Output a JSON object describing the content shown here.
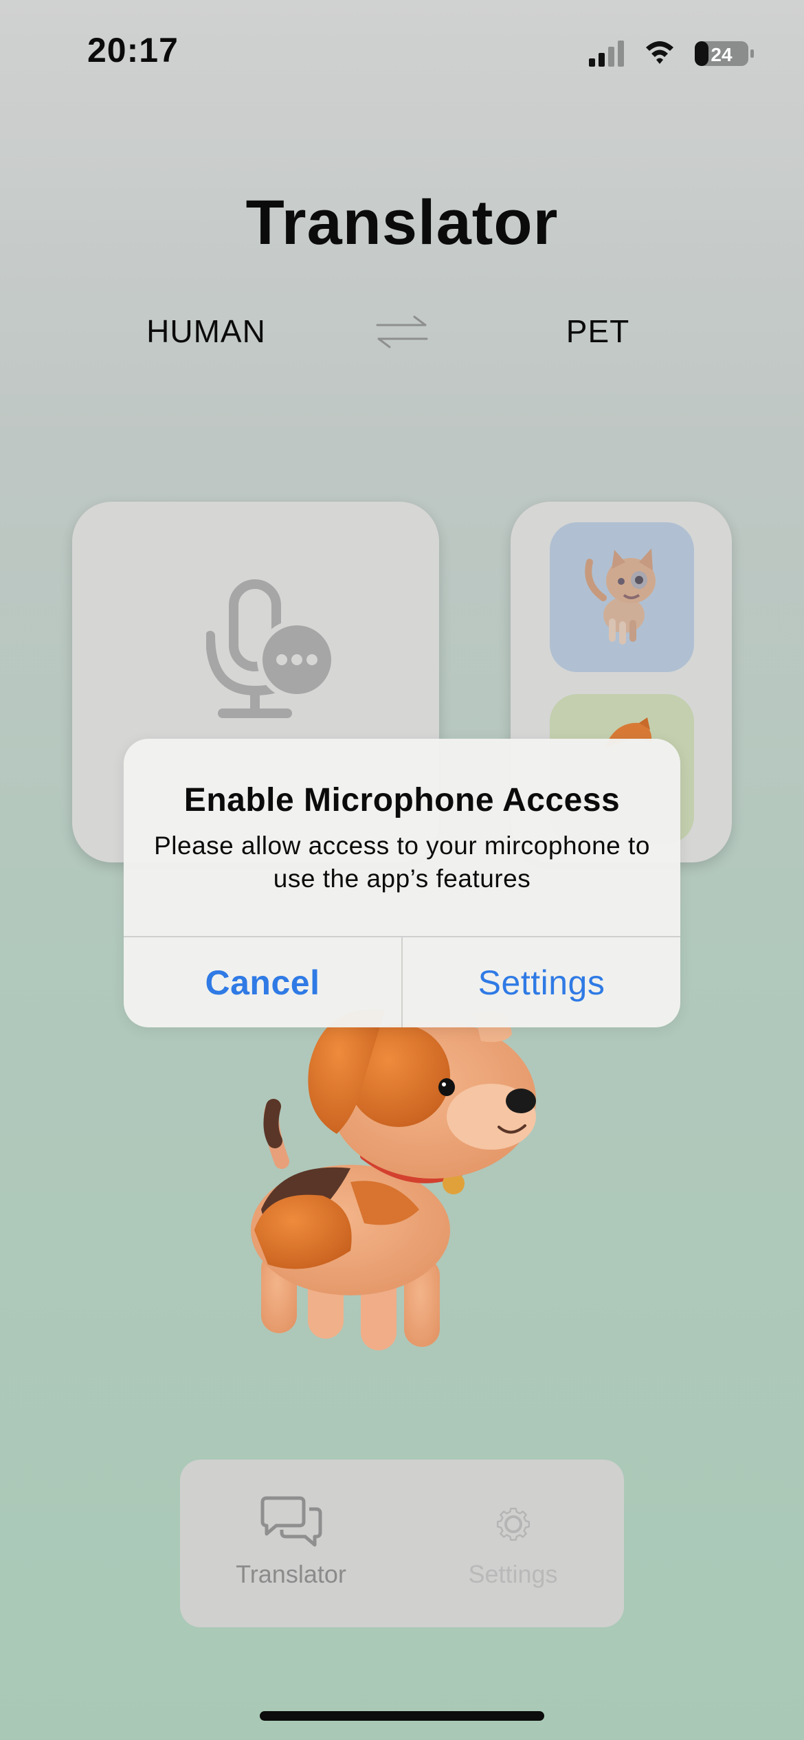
{
  "status_bar": {
    "time": "20:17",
    "battery": "24",
    "icons": [
      "cellular-signal-icon",
      "wifi-icon",
      "battery-icon"
    ]
  },
  "header": {
    "title": "Translator"
  },
  "languages": {
    "from": "HUMAN",
    "to": "PET",
    "swap_icon": "swap-arrows-icon"
  },
  "cards": {
    "record_icon": "microphone-ellipsis-icon",
    "pets": [
      "cat",
      "fox"
    ]
  },
  "alert": {
    "title": "Enable Microphone Access",
    "message": "Please allow access to your mircophone to use the app’s features",
    "cancel_label": "Cancel",
    "settings_label": "Settings"
  },
  "tabbar": {
    "items": [
      {
        "label": "Translator",
        "icon": "chat-bubbles-icon"
      },
      {
        "label": "Settings",
        "icon": "gear-icon"
      }
    ]
  },
  "colors": {
    "accent": "#2f7ae5",
    "alert_bg": "#f2f2f0",
    "card_bg": "#d6d6d5"
  }
}
